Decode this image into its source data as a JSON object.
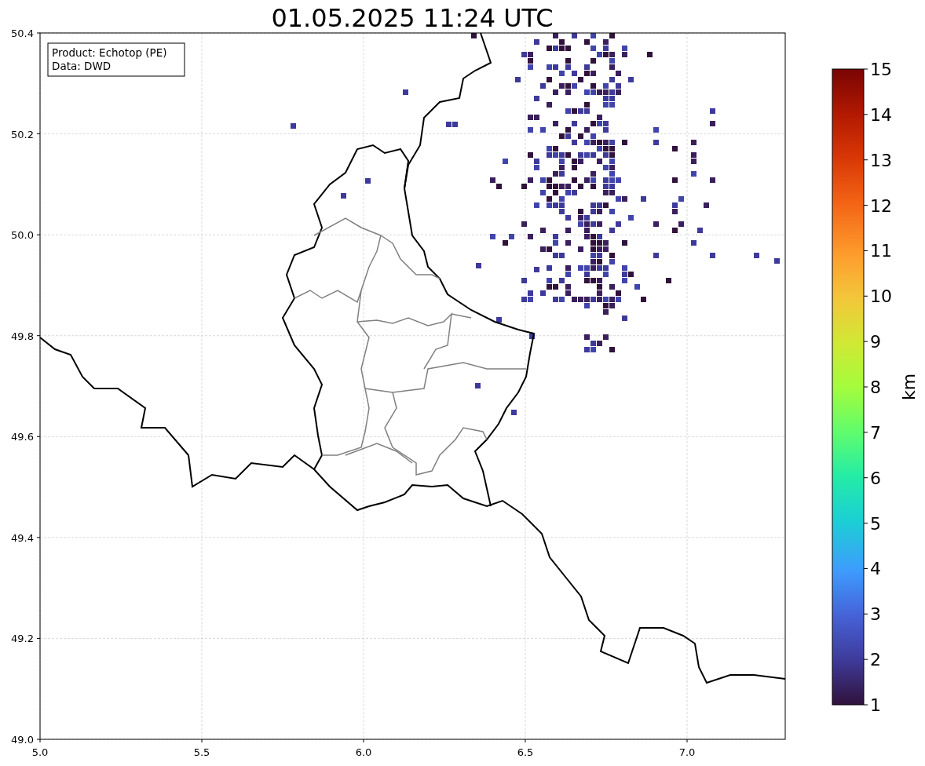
{
  "figure": {
    "title": "01.05.2025 11:24 UTC",
    "info_box": [
      "Product: Echotop (PE)",
      "Data: DWD"
    ],
    "x_axis": {
      "ticks": [
        "5.0",
        "5.5",
        "6.0",
        "6.5",
        "7.0"
      ]
    },
    "y_axis": {
      "ticks": [
        "50.4",
        "50.2",
        "50.0",
        "49.8",
        "49.6",
        "49.4",
        "49.2",
        "49.0"
      ]
    },
    "colorbar": {
      "label": "km",
      "ticks": [
        "15",
        "14",
        "13",
        "12",
        "11",
        "10",
        "9",
        "8",
        "7",
        "6",
        "5",
        "4",
        "3",
        "2",
        "1"
      ]
    }
  }
}
